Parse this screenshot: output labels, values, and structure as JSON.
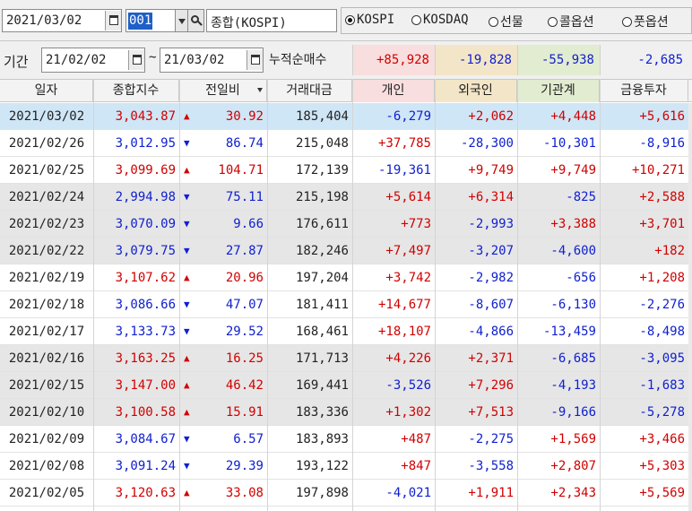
{
  "toolbar": {
    "date": "2021/03/02",
    "code": "001",
    "name": "종합(KOSPI)",
    "markets": [
      {
        "label": "KOSPI",
        "selected": true
      },
      {
        "label": "KOSDAQ",
        "selected": false
      },
      {
        "label": "선물",
        "selected": false
      },
      {
        "label": "콜옵션",
        "selected": false
      },
      {
        "label": "풋옵션",
        "selected": false
      }
    ]
  },
  "period": {
    "label": "기간",
    "from": "21/02/02",
    "sep": "~",
    "to": "21/03/02",
    "cum_label": "누적순매수",
    "totals": [
      {
        "value": "+85,928",
        "color": "#d10000",
        "bg": "#f8dede"
      },
      {
        "value": "-19,828",
        "color": "#1020d0",
        "bg": "#f3e6c8"
      },
      {
        "value": "-55,938",
        "color": "#1020d0",
        "bg": "#e2ecd0"
      },
      {
        "value": "-2,685",
        "color": "#1020d0",
        "bg": "#f0f0f0"
      }
    ]
  },
  "columns": [
    "일자",
    "종합지수",
    "전일비",
    "거래대금",
    "개인",
    "외국인",
    "기관계",
    "금융투자"
  ],
  "colors": {
    "up": "#d10000",
    "down": "#1020d0",
    "selected_row": "#cfe6f6",
    "alt_row": "#e6e6e6",
    "personal_head": "#f8dede",
    "foreign_head": "#f3e6c8",
    "inst_head": "#e2ecd0"
  },
  "rows": [
    {
      "date": "2021/03/02",
      "index": "3,043.87",
      "dir": "up",
      "change": "30.92",
      "amount": "185,404",
      "personal": "-6,279",
      "foreign": "+2,062",
      "inst": "+4,448",
      "fin": "+5,616",
      "shade": "sel"
    },
    {
      "date": "2021/02/26",
      "index": "3,012.95",
      "dir": "down",
      "change": "86.74",
      "amount": "215,048",
      "personal": "+37,785",
      "foreign": "-28,300",
      "inst": "-10,301",
      "fin": "-8,916",
      "shade": "white"
    },
    {
      "date": "2021/02/25",
      "index": "3,099.69",
      "dir": "up",
      "change": "104.71",
      "amount": "172,139",
      "personal": "-19,361",
      "foreign": "+9,749",
      "inst": "+9,749",
      "fin": "+10,271",
      "shade": "white"
    },
    {
      "date": "2021/02/24",
      "index": "2,994.98",
      "dir": "down",
      "change": "75.11",
      "amount": "215,198",
      "personal": "+5,614",
      "foreign": "+6,314",
      "inst": "-825",
      "fin": "+2,588",
      "shade": "gray"
    },
    {
      "date": "2021/02/23",
      "index": "3,070.09",
      "dir": "down",
      "change": "9.66",
      "amount": "176,611",
      "personal": "+773",
      "foreign": "-2,993",
      "inst": "+3,388",
      "fin": "+3,701",
      "shade": "gray"
    },
    {
      "date": "2021/02/22",
      "index": "3,079.75",
      "dir": "down",
      "change": "27.87",
      "amount": "182,246",
      "personal": "+7,497",
      "foreign": "-3,207",
      "inst": "-4,600",
      "fin": "+182",
      "shade": "gray"
    },
    {
      "date": "2021/02/19",
      "index": "3,107.62",
      "dir": "up",
      "change": "20.96",
      "amount": "197,204",
      "personal": "+3,742",
      "foreign": "-2,982",
      "inst": "-656",
      "fin": "+1,208",
      "shade": "white"
    },
    {
      "date": "2021/02/18",
      "index": "3,086.66",
      "dir": "down",
      "change": "47.07",
      "amount": "181,411",
      "personal": "+14,677",
      "foreign": "-8,607",
      "inst": "-6,130",
      "fin": "-2,276",
      "shade": "white"
    },
    {
      "date": "2021/02/17",
      "index": "3,133.73",
      "dir": "down",
      "change": "29.52",
      "amount": "168,461",
      "personal": "+18,107",
      "foreign": "-4,866",
      "inst": "-13,459",
      "fin": "-8,498",
      "shade": "white"
    },
    {
      "date": "2021/02/16",
      "index": "3,163.25",
      "dir": "up",
      "change": "16.25",
      "amount": "171,713",
      "personal": "+4,226",
      "foreign": "+2,371",
      "inst": "-6,685",
      "fin": "-3,095",
      "shade": "gray"
    },
    {
      "date": "2021/02/15",
      "index": "3,147.00",
      "dir": "up",
      "change": "46.42",
      "amount": "169,441",
      "personal": "-3,526",
      "foreign": "+7,296",
      "inst": "-4,193",
      "fin": "-1,683",
      "shade": "gray"
    },
    {
      "date": "2021/02/10",
      "index": "3,100.58",
      "dir": "up",
      "change": "15.91",
      "amount": "183,336",
      "personal": "+1,302",
      "foreign": "+7,513",
      "inst": "-9,166",
      "fin": "-5,278",
      "shade": "gray"
    },
    {
      "date": "2021/02/09",
      "index": "3,084.67",
      "dir": "down",
      "change": "6.57",
      "amount": "183,893",
      "personal": "+487",
      "foreign": "-2,275",
      "inst": "+1,569",
      "fin": "+3,466",
      "shade": "white"
    },
    {
      "date": "2021/02/08",
      "index": "3,091.24",
      "dir": "down",
      "change": "29.39",
      "amount": "193,122",
      "personal": "+847",
      "foreign": "-3,558",
      "inst": "+2,807",
      "fin": "+5,303",
      "shade": "white"
    },
    {
      "date": "2021/02/05",
      "index": "3,120.63",
      "dir": "up",
      "change": "33.08",
      "amount": "197,898",
      "personal": "-4,021",
      "foreign": "+1,911",
      "inst": "+2,343",
      "fin": "+5,569",
      "shade": "white"
    }
  ]
}
